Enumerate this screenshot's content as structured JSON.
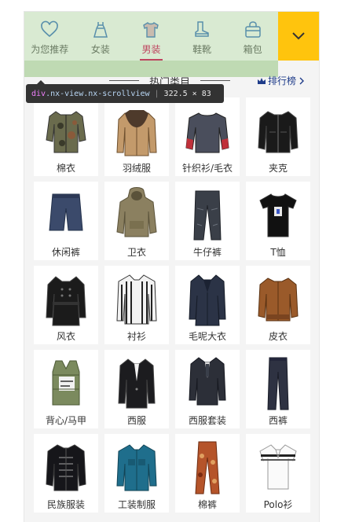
{
  "tabs": [
    {
      "label": "为您推荐",
      "icon": "heart-icon",
      "active": false
    },
    {
      "label": "女装",
      "icon": "dress-icon",
      "active": false
    },
    {
      "label": "男装",
      "icon": "shirt-icon",
      "active": true
    },
    {
      "label": "鞋靴",
      "icon": "boot-icon",
      "active": false
    },
    {
      "label": "箱包",
      "icon": "bag-icon",
      "active": false
    }
  ],
  "dropdown": {
    "icon": "chevron-down-icon"
  },
  "devtools_tooltip": {
    "tag": "div",
    "classes": ".nx-view.nx-scrollview",
    "dims": "322.5 × 83"
  },
  "section": {
    "title": "热门类目",
    "rank_label": "排行榜",
    "rank_icon": "crown-icon",
    "arrow_icon": "chevron-right-icon"
  },
  "categories": [
    {
      "name": "棉衣",
      "icon": "camo-jacket-icon"
    },
    {
      "name": "羽绒服",
      "icon": "fur-collar-coat-icon"
    },
    {
      "name": "针织衫/毛衣",
      "icon": "sweater-icon"
    },
    {
      "name": "夹克",
      "icon": "jacket-icon"
    },
    {
      "name": "休闲裤",
      "icon": "shorts-icon"
    },
    {
      "name": "卫衣",
      "icon": "hoodie-icon"
    },
    {
      "name": "牛仔裤",
      "icon": "jeans-icon"
    },
    {
      "name": "T恤",
      "icon": "tshirt-icon"
    },
    {
      "name": "风衣",
      "icon": "trench-coat-icon"
    },
    {
      "name": "衬衫",
      "icon": "striped-shirt-icon"
    },
    {
      "name": "毛呢大衣",
      "icon": "wool-coat-icon"
    },
    {
      "name": "皮衣",
      "icon": "leather-jacket-icon"
    },
    {
      "name": "背心/马甲",
      "icon": "vest-icon"
    },
    {
      "name": "西服",
      "icon": "suit-jacket-icon"
    },
    {
      "name": "西服套装",
      "icon": "suit-set-icon"
    },
    {
      "name": "西裤",
      "icon": "trousers-icon"
    },
    {
      "name": "民族服装",
      "icon": "tang-suit-icon"
    },
    {
      "name": "工装制服",
      "icon": "work-shirt-icon"
    },
    {
      "name": "棉裤",
      "icon": "print-pants-icon"
    },
    {
      "name": "Polo衫",
      "icon": "polo-shirt-icon"
    }
  ],
  "colors": {
    "accent": "#d6004f",
    "dropdown_bg": "#ffc40d",
    "tab_icon": "#3b73c4",
    "link": "#1f3c8a"
  }
}
